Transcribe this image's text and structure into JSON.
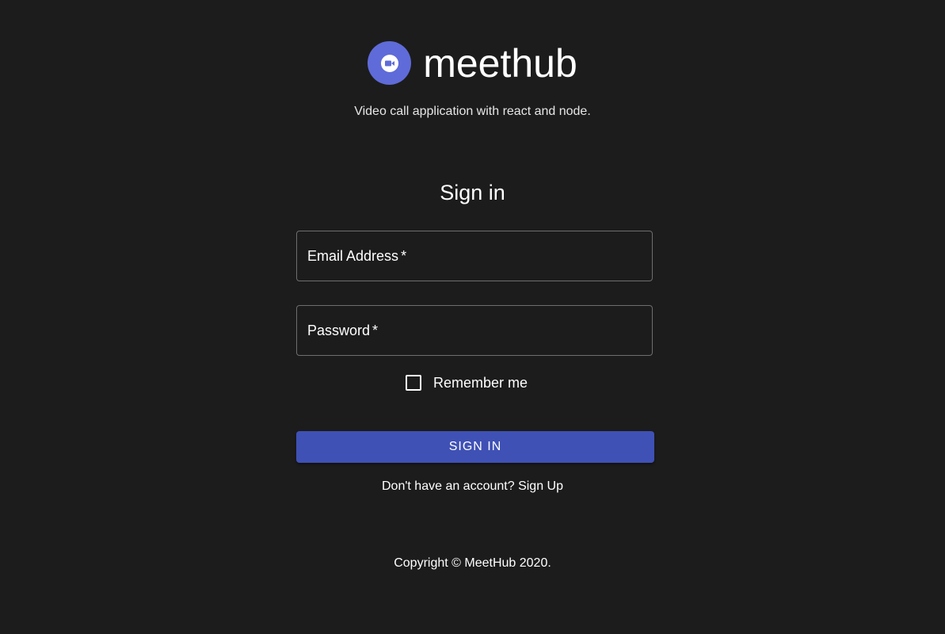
{
  "brand": {
    "name": "meethub",
    "logo_icon": "video-camera-icon",
    "logo_color": "#5f6bd8"
  },
  "tagline": "Video call application with react and node.",
  "form": {
    "title": "Sign in",
    "email": {
      "label": "Email Address",
      "required_mark": "*",
      "value": ""
    },
    "password": {
      "label": "Password",
      "required_mark": "*",
      "value": ""
    },
    "remember_me": {
      "label": "Remember me",
      "checked": false
    },
    "submit_label": "SIGN IN",
    "submit_color": "#3f51b5",
    "signup_link": "Don't have an account? Sign Up"
  },
  "footer": {
    "copyright": "Copyright © MeetHub 2020."
  },
  "colors": {
    "background": "#1c1c1c"
  }
}
